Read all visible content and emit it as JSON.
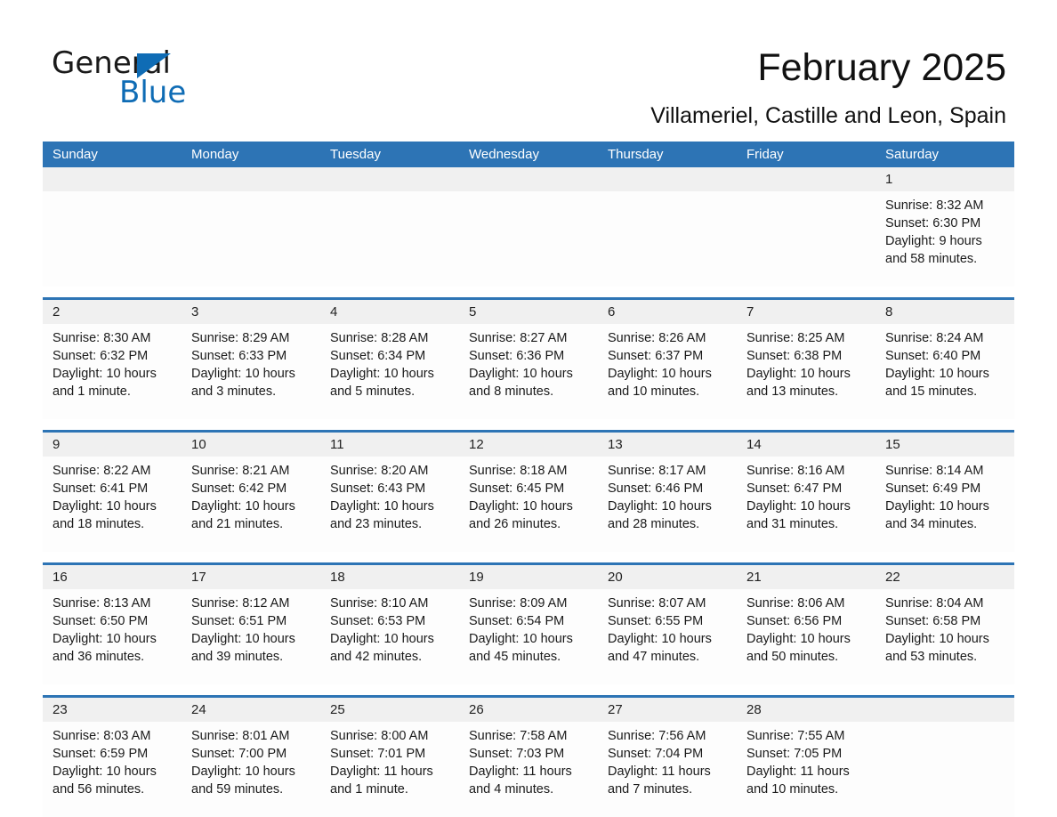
{
  "brand": {
    "line1": "General",
    "line2": "Blue",
    "accent_color": "#0f6cb5"
  },
  "header": {
    "month_title": "February 2025",
    "location": "Villameriel, Castille and Leon, Spain"
  },
  "calendar": {
    "header_color": "#2d74b5",
    "date_band_color": "#f0f0f0",
    "weekdays": [
      "Sunday",
      "Monday",
      "Tuesday",
      "Wednesday",
      "Thursday",
      "Friday",
      "Saturday"
    ],
    "weeks": [
      [
        {
          "day": "",
          "lines": []
        },
        {
          "day": "",
          "lines": []
        },
        {
          "day": "",
          "lines": []
        },
        {
          "day": "",
          "lines": []
        },
        {
          "day": "",
          "lines": []
        },
        {
          "day": "",
          "lines": []
        },
        {
          "day": "1",
          "lines": [
            "Sunrise: 8:32 AM",
            "Sunset: 6:30 PM",
            "Daylight: 9 hours",
            "and 58 minutes."
          ]
        }
      ],
      [
        {
          "day": "2",
          "lines": [
            "Sunrise: 8:30 AM",
            "Sunset: 6:32 PM",
            "Daylight: 10 hours",
            "and 1 minute."
          ]
        },
        {
          "day": "3",
          "lines": [
            "Sunrise: 8:29 AM",
            "Sunset: 6:33 PM",
            "Daylight: 10 hours",
            "and 3 minutes."
          ]
        },
        {
          "day": "4",
          "lines": [
            "Sunrise: 8:28 AM",
            "Sunset: 6:34 PM",
            "Daylight: 10 hours",
            "and 5 minutes."
          ]
        },
        {
          "day": "5",
          "lines": [
            "Sunrise: 8:27 AM",
            "Sunset: 6:36 PM",
            "Daylight: 10 hours",
            "and 8 minutes."
          ]
        },
        {
          "day": "6",
          "lines": [
            "Sunrise: 8:26 AM",
            "Sunset: 6:37 PM",
            "Daylight: 10 hours",
            "and 10 minutes."
          ]
        },
        {
          "day": "7",
          "lines": [
            "Sunrise: 8:25 AM",
            "Sunset: 6:38 PM",
            "Daylight: 10 hours",
            "and 13 minutes."
          ]
        },
        {
          "day": "8",
          "lines": [
            "Sunrise: 8:24 AM",
            "Sunset: 6:40 PM",
            "Daylight: 10 hours",
            "and 15 minutes."
          ]
        }
      ],
      [
        {
          "day": "9",
          "lines": [
            "Sunrise: 8:22 AM",
            "Sunset: 6:41 PM",
            "Daylight: 10 hours",
            "and 18 minutes."
          ]
        },
        {
          "day": "10",
          "lines": [
            "Sunrise: 8:21 AM",
            "Sunset: 6:42 PM",
            "Daylight: 10 hours",
            "and 21 minutes."
          ]
        },
        {
          "day": "11",
          "lines": [
            "Sunrise: 8:20 AM",
            "Sunset: 6:43 PM",
            "Daylight: 10 hours",
            "and 23 minutes."
          ]
        },
        {
          "day": "12",
          "lines": [
            "Sunrise: 8:18 AM",
            "Sunset: 6:45 PM",
            "Daylight: 10 hours",
            "and 26 minutes."
          ]
        },
        {
          "day": "13",
          "lines": [
            "Sunrise: 8:17 AM",
            "Sunset: 6:46 PM",
            "Daylight: 10 hours",
            "and 28 minutes."
          ]
        },
        {
          "day": "14",
          "lines": [
            "Sunrise: 8:16 AM",
            "Sunset: 6:47 PM",
            "Daylight: 10 hours",
            "and 31 minutes."
          ]
        },
        {
          "day": "15",
          "lines": [
            "Sunrise: 8:14 AM",
            "Sunset: 6:49 PM",
            "Daylight: 10 hours",
            "and 34 minutes."
          ]
        }
      ],
      [
        {
          "day": "16",
          "lines": [
            "Sunrise: 8:13 AM",
            "Sunset: 6:50 PM",
            "Daylight: 10 hours",
            "and 36 minutes."
          ]
        },
        {
          "day": "17",
          "lines": [
            "Sunrise: 8:12 AM",
            "Sunset: 6:51 PM",
            "Daylight: 10 hours",
            "and 39 minutes."
          ]
        },
        {
          "day": "18",
          "lines": [
            "Sunrise: 8:10 AM",
            "Sunset: 6:53 PM",
            "Daylight: 10 hours",
            "and 42 minutes."
          ]
        },
        {
          "day": "19",
          "lines": [
            "Sunrise: 8:09 AM",
            "Sunset: 6:54 PM",
            "Daylight: 10 hours",
            "and 45 minutes."
          ]
        },
        {
          "day": "20",
          "lines": [
            "Sunrise: 8:07 AM",
            "Sunset: 6:55 PM",
            "Daylight: 10 hours",
            "and 47 minutes."
          ]
        },
        {
          "day": "21",
          "lines": [
            "Sunrise: 8:06 AM",
            "Sunset: 6:56 PM",
            "Daylight: 10 hours",
            "and 50 minutes."
          ]
        },
        {
          "day": "22",
          "lines": [
            "Sunrise: 8:04 AM",
            "Sunset: 6:58 PM",
            "Daylight: 10 hours",
            "and 53 minutes."
          ]
        }
      ],
      [
        {
          "day": "23",
          "lines": [
            "Sunrise: 8:03 AM",
            "Sunset: 6:59 PM",
            "Daylight: 10 hours",
            "and 56 minutes."
          ]
        },
        {
          "day": "24",
          "lines": [
            "Sunrise: 8:01 AM",
            "Sunset: 7:00 PM",
            "Daylight: 10 hours",
            "and 59 minutes."
          ]
        },
        {
          "day": "25",
          "lines": [
            "Sunrise: 8:00 AM",
            "Sunset: 7:01 PM",
            "Daylight: 11 hours",
            "and 1 minute."
          ]
        },
        {
          "day": "26",
          "lines": [
            "Sunrise: 7:58 AM",
            "Sunset: 7:03 PM",
            "Daylight: 11 hours",
            "and 4 minutes."
          ]
        },
        {
          "day": "27",
          "lines": [
            "Sunrise: 7:56 AM",
            "Sunset: 7:04 PM",
            "Daylight: 11 hours",
            "and 7 minutes."
          ]
        },
        {
          "day": "28",
          "lines": [
            "Sunrise: 7:55 AM",
            "Sunset: 7:05 PM",
            "Daylight: 11 hours",
            "and 10 minutes."
          ]
        },
        {
          "day": "",
          "lines": []
        }
      ]
    ]
  }
}
